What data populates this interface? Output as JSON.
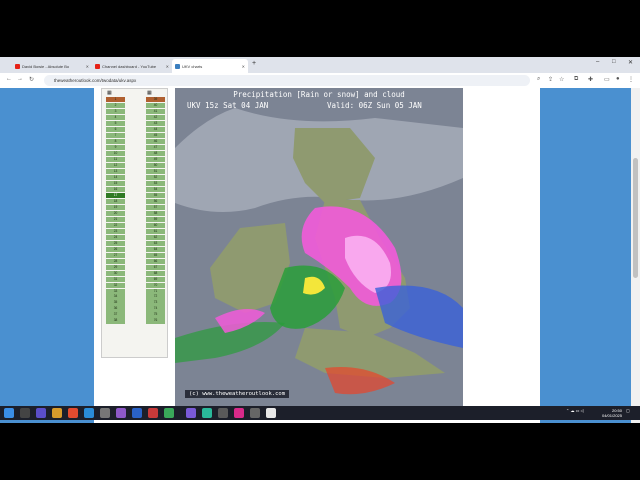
{
  "browser": {
    "tabs": [
      {
        "title": "David Bowie - Absolute Bo",
        "favicon_color": "#e62117"
      },
      {
        "title": "Channel dashboard - YouTube",
        "favicon_color": "#e62117"
      },
      {
        "title": "UKV charts",
        "favicon_color": "#3a7ebf",
        "active": true
      }
    ],
    "url": "theweatheroutlook.com/twodata/ukv.aspx"
  },
  "panel": {
    "col_a_header": "▦",
    "col_b_header": "▦",
    "col_a": [
      "1",
      "2",
      "3",
      "4",
      "5",
      "6",
      "7",
      "8",
      "9",
      "10",
      "11",
      "12",
      "13",
      "14",
      "15",
      "16",
      "17",
      "18",
      "19",
      "20",
      "21",
      "22",
      "23",
      "24",
      "25",
      "26",
      "27",
      "28",
      "29",
      "30",
      "31",
      "32",
      "33",
      "34",
      "35",
      "36",
      "37",
      "38"
    ],
    "col_b": [
      "39",
      "40",
      "41",
      "42",
      "43",
      "44",
      "45",
      "46",
      "47",
      "48",
      "49",
      "50",
      "51",
      "52",
      "53",
      "54",
      "55",
      "56",
      "57",
      "58",
      "59",
      "60",
      "61",
      "62",
      "63",
      "64",
      "65",
      "66",
      "67",
      "68",
      "69",
      "70",
      "71",
      "72",
      "73",
      "74",
      "75",
      "76"
    ],
    "selected_index": 16
  },
  "chart": {
    "title": "Precipitation [Rain or snow] and cloud",
    "run": "UKV 15z Sat 04 JAN",
    "valid": "Valid: 06Z Sun 05 JAN",
    "credit": "(c) www.theweatheroutlook.com"
  },
  "taskbar": {
    "time": "20:50",
    "date": "04/01/2025"
  }
}
